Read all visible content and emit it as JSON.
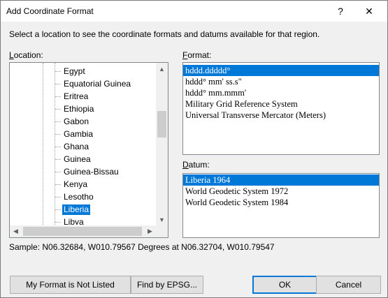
{
  "window": {
    "title": "Add Coordinate Format",
    "help_label": "?",
    "close_label": "✕"
  },
  "instructions": "Select a location to see the coordinate formats and datums available for that region.",
  "location": {
    "label": "Location:",
    "items": [
      "Egypt",
      "Equatorial Guinea",
      "Eritrea",
      "Ethiopia",
      "Gabon",
      "Gambia",
      "Ghana",
      "Guinea",
      "Guinea-Bissau",
      "Kenya",
      "Lesotho",
      "Liberia",
      "Libya"
    ],
    "selected": "Liberia"
  },
  "format": {
    "label": "Format:",
    "items": [
      "hddd.ddddd°",
      "hddd° mm' ss.s\"",
      "hddd° mm.mmm'",
      "Military Grid Reference System",
      "Universal Transverse Mercator (Meters)"
    ],
    "selected": "hddd.ddddd°"
  },
  "datum": {
    "label": "Datum:",
    "items": [
      "Liberia 1964",
      "World Geodetic System 1972",
      "World Geodetic System 1984"
    ],
    "selected": "Liberia 1964"
  },
  "sample": "Sample: N06.32684, W010.79567 Degrees at N06.32704, W010.79547",
  "buttons": {
    "not_listed": "My Format is Not Listed",
    "find_epsg": "Find by EPSG...",
    "ok": "OK",
    "cancel": "Cancel"
  },
  "colors": {
    "selection": "#0078d7",
    "dialog_bg": "#f0f0f0"
  },
  "icons": {
    "scroll_up": "▲",
    "scroll_down": "▼",
    "scroll_left": "◀",
    "scroll_right": "▶"
  }
}
